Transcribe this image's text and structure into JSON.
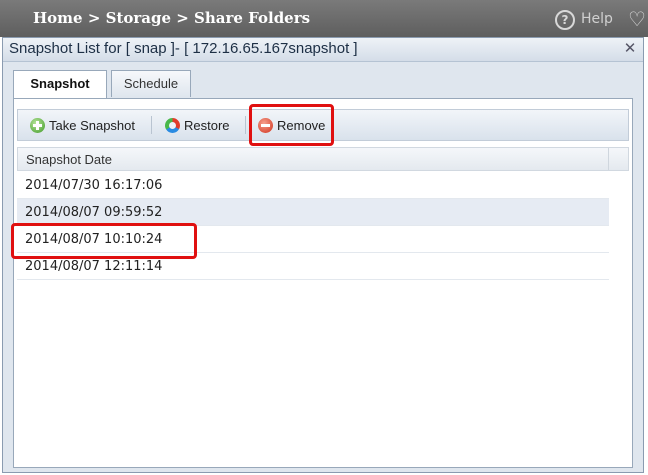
{
  "breadcrumb": "Home > Storage > Share Folders",
  "help_label": "Help",
  "dialog": {
    "title": "Snapshot List for [ snap ]- [ 172.16.65.167snapshot ]",
    "close_symbol": "✕"
  },
  "tabs": [
    {
      "label": "Snapshot",
      "active": true
    },
    {
      "label": "Schedule",
      "active": false
    }
  ],
  "toolbar": {
    "take_snapshot_label": "Take Snapshot",
    "restore_label": "Restore",
    "remove_label": "Remove"
  },
  "grid": {
    "column_header": "Snapshot Date",
    "rows": [
      {
        "date": "2014/07/30 16:17:06"
      },
      {
        "date": "2014/08/07 09:59:52"
      },
      {
        "date": "2014/08/07 10:10:24"
      },
      {
        "date": "2014/08/07 12:11:14"
      }
    ]
  },
  "colors": {
    "highlight": "#e01010",
    "topbar": "#6a6a6a",
    "dialog_bg": "#dfe6ee"
  },
  "icons": [
    "help-icon",
    "favorite-icon",
    "close-icon",
    "add-icon",
    "restore-icon",
    "remove-icon"
  ]
}
